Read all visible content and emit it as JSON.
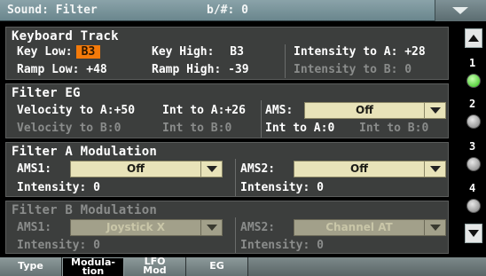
{
  "title_bar": {
    "title": "Sound: Filter",
    "key": "b/#: 0"
  },
  "keyboard_track": {
    "title": "Keyboard Track",
    "key_low_label": "Key Low:",
    "key_low_value": "B3",
    "key_high_label": "Key High:",
    "key_high_value": "B3",
    "intensity_a": "Intensity to A: +28",
    "ramp_low": "Ramp Low: +48",
    "ramp_high": "Ramp High: -39",
    "intensity_b": "Intensity to B: 0"
  },
  "filter_eg": {
    "title": "Filter EG",
    "velocity_a": "Velocity to A:+50",
    "int_a": "Int to A:+26",
    "ams_label": "AMS:",
    "ams_value": "Off",
    "velocity_b": "Velocity to B:0",
    "int_b": "Int to B:0",
    "ams_int_a": "Int to A:0",
    "ams_int_b": "Int to B:0"
  },
  "filter_a_mod": {
    "title": "Filter A Modulation",
    "ams1_label": "AMS1:",
    "ams1_value": "Off",
    "ams2_label": "AMS2:",
    "ams2_value": "Off",
    "intensity1": "Intensity: 0",
    "intensity2": "Intensity: 0"
  },
  "filter_b_mod": {
    "title": "Filter B Modulation",
    "ams1_label": "AMS1:",
    "ams1_value": "Joystick X",
    "ams2_label": "AMS2:",
    "ams2_value": "Channel AT",
    "intensity1": "Intensity: 0",
    "intensity2": "Intensity: 0"
  },
  "sidebar": {
    "n1": "1",
    "n2": "2",
    "n3": "3",
    "n4": "4"
  },
  "tabs": {
    "type": "Type",
    "mod1": "Modula-",
    "mod2": "tion",
    "lfo1": "LFO",
    "lfo2": "Mod",
    "eg": "EG"
  },
  "colors": {
    "highlight": "#f47a0a",
    "active_led": "#2fbf14",
    "dropdown": "#e8e3b9",
    "panel": "#3c3e3d"
  },
  "icons": {
    "menu": "menu-triangle-icon",
    "scroll_up": "up-arrow-icon",
    "scroll_down": "down-arrow-icon",
    "dropdown": "dropdown-arrow-icon"
  }
}
